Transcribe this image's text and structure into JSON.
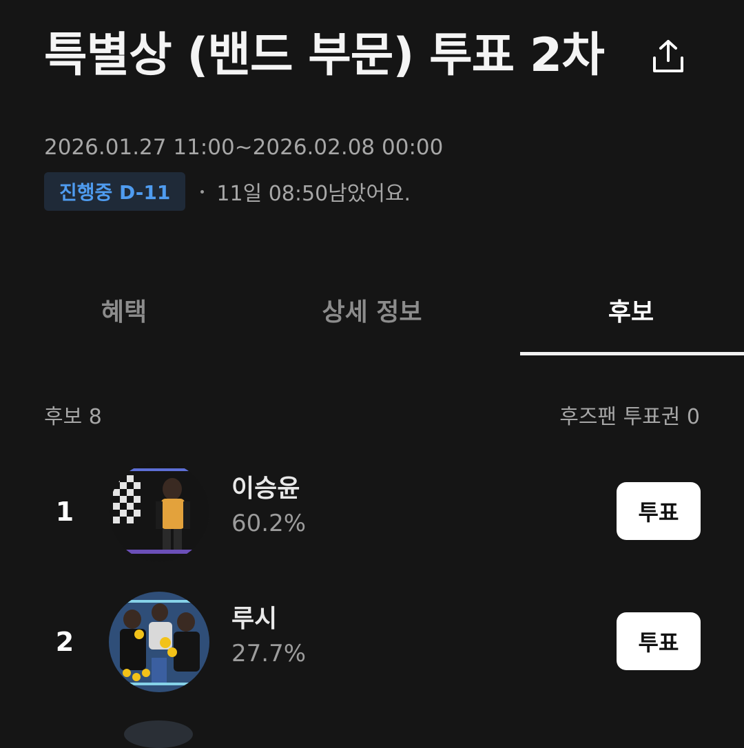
{
  "header": {
    "title": "특별상 (밴드 부문) 투표 2차",
    "share_icon": "share-icon"
  },
  "event": {
    "date_range": "2026.01.27 11:00~2026.02.08 00:00",
    "status_badge": "진행중 D-11",
    "remaining": "11일 08:50남았어요."
  },
  "tabs": [
    {
      "label": "혜택",
      "active": false
    },
    {
      "label": "상세 정보",
      "active": false
    },
    {
      "label": "후보",
      "active": true
    }
  ],
  "summary": {
    "candidates": "후보 8",
    "vote_tickets": "후즈팬 투표권 0"
  },
  "candidates": [
    {
      "rank": "1",
      "name": "이승윤",
      "percent": "60.2%",
      "vote_label": "투표"
    },
    {
      "rank": "2",
      "name": "루시",
      "percent": "27.7%",
      "vote_label": "투표"
    }
  ],
  "colors": {
    "background": "#151515",
    "accent_blue": "#4f9cf0",
    "badge_bg": "#1f2a38"
  }
}
